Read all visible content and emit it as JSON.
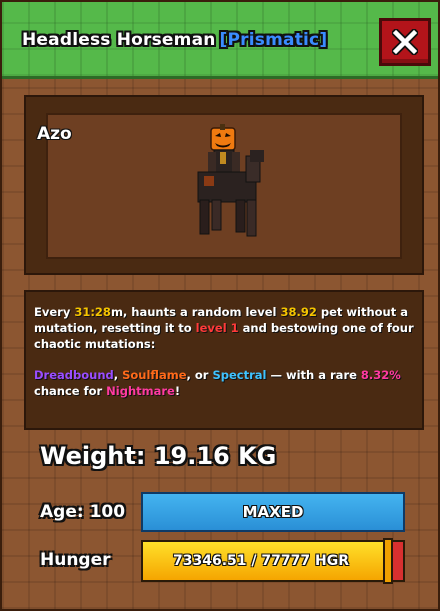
{
  "header": {
    "title": "Headless Horseman",
    "rarity": "[Prismatic]",
    "close_label": "X"
  },
  "pet": {
    "name": "Azo",
    "model_icon": "headless-horseman-model"
  },
  "description": {
    "p1": [
      {
        "text": "Every ",
        "color": ""
      },
      {
        "text": "31:28",
        "color": "yellow"
      },
      {
        "text": "m, haunts a random level ",
        "color": ""
      },
      {
        "text": "38.92",
        "color": "yellow"
      },
      {
        "text": " pet without a mutation, resetting it to ",
        "color": ""
      },
      {
        "text": "level 1",
        "color": "red"
      },
      {
        "text": " and bestowing one of four chaotic mutations:",
        "color": ""
      }
    ],
    "p2": [
      {
        "text": "Dreadbound",
        "color": "purple"
      },
      {
        "text": ", ",
        "color": ""
      },
      {
        "text": "Soulflame",
        "color": "orange"
      },
      {
        "text": ", or ",
        "color": ""
      },
      {
        "text": "Spectral",
        "color": "cyan"
      },
      {
        "text": " — with a rare ",
        "color": ""
      },
      {
        "text": "8.32%",
        "color": "pink"
      },
      {
        "text": " chance for ",
        "color": ""
      },
      {
        "text": "Nightmare",
        "color": "pink"
      },
      {
        "text": "!",
        "color": ""
      }
    ]
  },
  "stats": {
    "weight_label": "Weight: 19.16 KG",
    "age_label": "Age: 100",
    "age_status": "MAXED",
    "hunger_label": "Hunger",
    "hunger_text": "73346.51 / 77777 HGR",
    "hunger_current": 73346.51,
    "hunger_max": 77777
  },
  "colors": {
    "header_green": "#55b94a",
    "close_red": "#b3141a",
    "age_blue": "#2a8fd6",
    "hunger_yellow": "#ffe02a",
    "hunger_red": "#d83030"
  }
}
